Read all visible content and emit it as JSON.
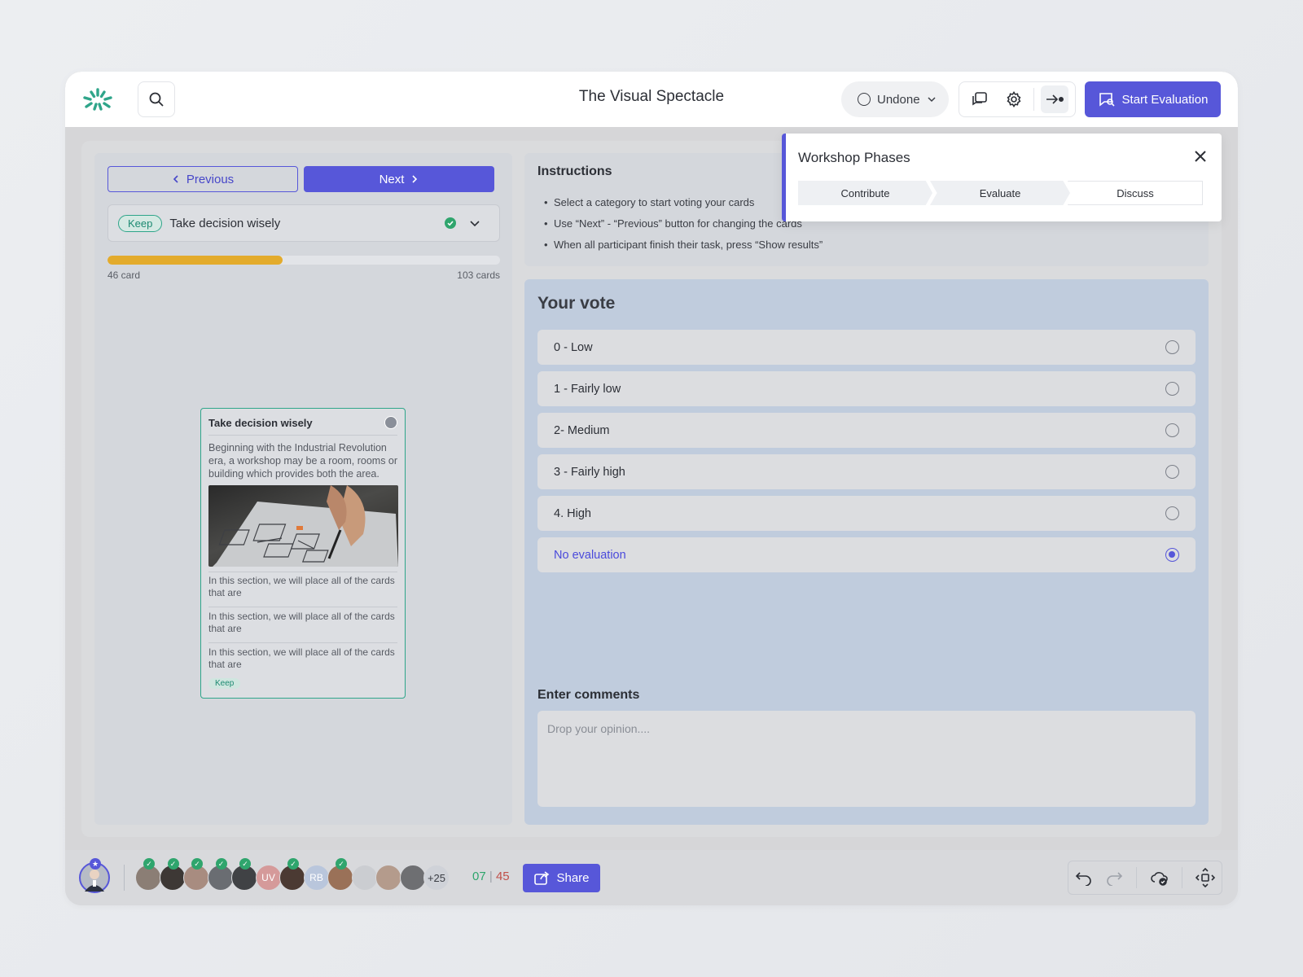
{
  "header": {
    "title": "The Visual Spectacle",
    "status_label": "Undone",
    "start_label": "Start Evaluation",
    "search_placeholder": ""
  },
  "navigation": {
    "previous_label": "Previous",
    "next_label": "Next"
  },
  "card_select": {
    "tag": "Keep",
    "title": "Take decision wisely"
  },
  "progress": {
    "current_label": "46 card",
    "total_label": "103 cards",
    "fraction": 0.4466
  },
  "card": {
    "title": "Take decision wisely",
    "description": "Beginning with the Industrial Revolution era, a workshop may be a room, rooms or building which provides both the area.",
    "notes": [
      "In this section, we will place all of the cards that are",
      "In this section, we will place all of the cards that are",
      "In this section, we will place all of the cards that are"
    ],
    "tag": "Keep"
  },
  "instructions": {
    "title": "Instructions",
    "items": [
      "Select a category to start voting your cards",
      "Use “Next” - “Previous” button for changing the cards",
      "When all participant finish their task, press “Show results”"
    ]
  },
  "vote": {
    "title": "Your vote",
    "options": [
      {
        "label": "0 - Low",
        "selected": false
      },
      {
        "label": "1 - Fairly low",
        "selected": false
      },
      {
        "label": "2- Medium",
        "selected": false
      },
      {
        "label": "3 - Fairly high",
        "selected": false
      },
      {
        "label": "4. High",
        "selected": false
      },
      {
        "label": "No evaluation",
        "selected": true
      }
    ],
    "comments_label": "Enter comments",
    "comments_placeholder": "Drop your opinion...."
  },
  "phases": {
    "title": "Workshop Phases",
    "steps": [
      "Contribute",
      "Evaluate",
      "Discuss"
    ]
  },
  "footer": {
    "participants": [
      {
        "initials": "",
        "color": "#8b7e75",
        "checked": true
      },
      {
        "initials": "",
        "color": "#3d3835",
        "checked": true
      },
      {
        "initials": "",
        "color": "#a88c80",
        "checked": true
      },
      {
        "initials": "",
        "color": "#6a6d72",
        "checked": true
      },
      {
        "initials": "",
        "color": "#404245",
        "checked": true
      },
      {
        "initials": "UV",
        "color": "#d59a9a",
        "checked": false
      },
      {
        "initials": "",
        "color": "#4b3a33",
        "checked": true
      },
      {
        "initials": "RB",
        "color": "#b9c6dc",
        "checked": false
      },
      {
        "initials": "",
        "color": "#9a7158",
        "checked": true
      },
      {
        "initials": "",
        "color": "#cbcdd1",
        "checked": false
      },
      {
        "initials": "",
        "color": "#b49b8c",
        "checked": false
      },
      {
        "initials": "",
        "color": "#6e6f72",
        "checked": false
      }
    ],
    "more_label": "+25",
    "done_count": "07",
    "total_count": "45",
    "share_label": "Share"
  },
  "colors": {
    "accent": "#5757d9",
    "success": "#2fa56d",
    "progress": "#e3ab2c",
    "tag": "#2fa58a"
  }
}
